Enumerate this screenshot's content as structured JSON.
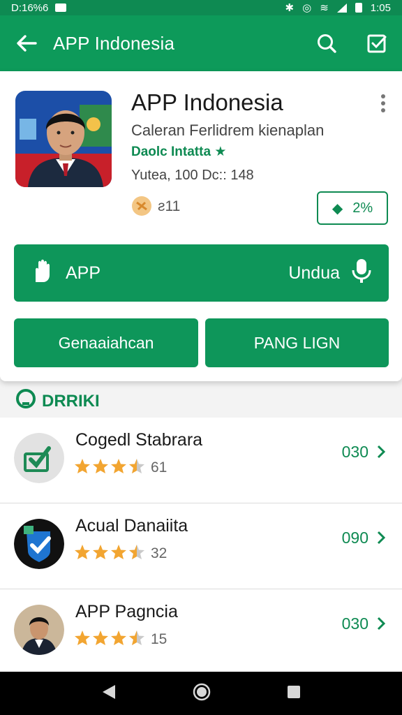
{
  "status_bar": {
    "time_left": "D:16%6",
    "time_right": "1:05"
  },
  "app_bar": {
    "title": "APP Indonesia"
  },
  "app": {
    "name": "APP Indonesia",
    "subtitle": "Caleran Ferlidrem kienaplan",
    "developer": "Daolc Intatta",
    "developer_mark": "★",
    "meta": "Yutea, 100 Dc:: 148",
    "rating_count": "ƨ11",
    "percent": "2%"
  },
  "buttons": {
    "main_left": "APP",
    "main_right": "Undua",
    "secondary_left": "Genaaiahcan",
    "secondary_right": "PANG LIGN"
  },
  "section": {
    "title": "DRRIKI"
  },
  "list": [
    {
      "name": "Cogedl Stabrara",
      "rating": 3.5,
      "count": "61",
      "value": "030"
    },
    {
      "name": "Acual Danaiita",
      "rating": 3.5,
      "count": "32",
      "value": "090"
    },
    {
      "name": "APP Pagncia",
      "rating": 3.5,
      "count": "15",
      "value": "030"
    }
  ],
  "colors": {
    "primary": "#0d9a5a",
    "accent_text": "#0e8a52",
    "star": "#f2a531"
  },
  "icons": [
    "back-arrow-icon",
    "search-icon",
    "checkbox-icon",
    "more-vert-icon",
    "hand-icon",
    "microphone-icon",
    "chevron-right-icon"
  ]
}
